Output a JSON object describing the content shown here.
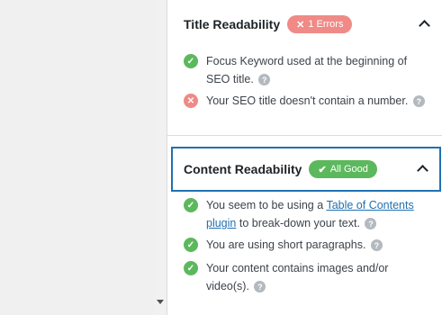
{
  "title_readability": {
    "title": "Title Readability",
    "badge_icon": "✕",
    "badge_text": "1 Errors",
    "items": [
      {
        "status": "pass",
        "text": "Focus Keyword used at the beginning of SEO title."
      },
      {
        "status": "fail",
        "text": "Your SEO title doesn't contain a number."
      }
    ]
  },
  "content_readability": {
    "title": "Content Readability",
    "badge_icon": "✔",
    "badge_text": "All Good",
    "items": [
      {
        "status": "pass",
        "text_before": "You seem to be using a ",
        "link_text": "Table of Contents plugin",
        "text_after": " to break-down your text."
      },
      {
        "status": "pass",
        "text": "You are using short paragraphs."
      },
      {
        "status": "pass",
        "text": "Your content contains images and/or video(s)."
      }
    ]
  },
  "icons": {
    "pass": "✓",
    "fail": "✕",
    "help": "?"
  },
  "colors": {
    "error_badge": "#ef8a87",
    "good_badge": "#5cb85c",
    "link": "#2271b1",
    "focus_border": "#2271b1"
  }
}
